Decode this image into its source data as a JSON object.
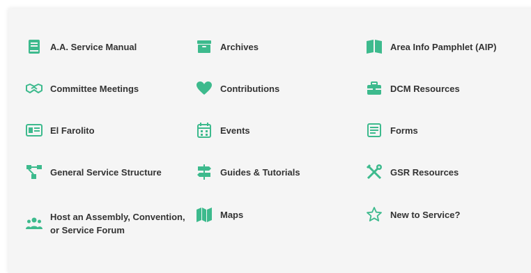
{
  "accent_color": "#3dba8d",
  "resources": [
    {
      "label": "A.A. Service Manual",
      "icon": "book-icon"
    },
    {
      "label": "Archives",
      "icon": "archive-box-icon"
    },
    {
      "label": "Area Info Pamphlet (AIP)",
      "icon": "open-map-book-icon"
    },
    {
      "label": "Committee Meetings",
      "icon": "handshake-icon"
    },
    {
      "label": "Contributions",
      "icon": "heart-icon"
    },
    {
      "label": "DCM Resources",
      "icon": "briefcase-icon"
    },
    {
      "label": "El Farolito",
      "icon": "newspaper-icon"
    },
    {
      "label": "Events",
      "icon": "calendar-icon"
    },
    {
      "label": "Forms",
      "icon": "form-document-icon"
    },
    {
      "label": "General Service Structure",
      "icon": "org-chart-icon"
    },
    {
      "label": "Guides & Tutorials",
      "icon": "signpost-icon"
    },
    {
      "label": "GSR Resources",
      "icon": "tools-icon"
    },
    {
      "label": "Host an Assembly, Convention, or Service Forum",
      "icon": "people-group-icon"
    },
    {
      "label": "Maps",
      "icon": "map-icon"
    },
    {
      "label": "New to Service?",
      "icon": "star-icon"
    }
  ]
}
